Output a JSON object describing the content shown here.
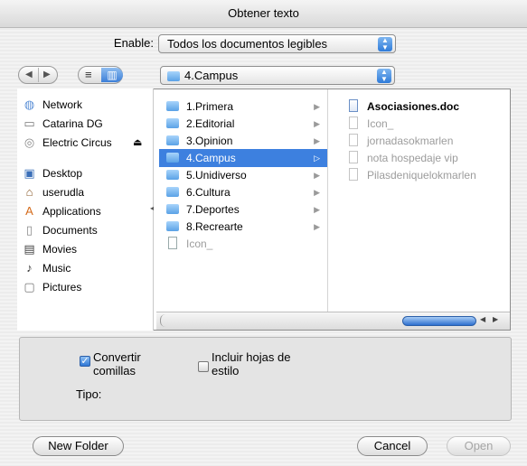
{
  "window": {
    "title": "Obtener texto"
  },
  "enable": {
    "label": "Enable:",
    "value": "Todos los documentos legibles"
  },
  "nav": {
    "back": "◀",
    "forward": "▶",
    "list_view": "≡",
    "column_view": "▥"
  },
  "location": {
    "value": "4.Campus"
  },
  "sidebar": {
    "items": [
      {
        "label": "Network",
        "icon": "network-icon"
      },
      {
        "label": "Catarina DG",
        "icon": "hard-drive-icon"
      },
      {
        "label": "Electric Circus",
        "icon": "cd-icon",
        "eject": "⏏"
      },
      {
        "label": "Desktop",
        "icon": "desktop-icon"
      },
      {
        "label": "userudla",
        "icon": "home-icon"
      },
      {
        "label": "Applications",
        "icon": "applications-icon"
      },
      {
        "label": "Documents",
        "icon": "documents-icon"
      },
      {
        "label": "Movies",
        "icon": "movies-icon"
      },
      {
        "label": "Music",
        "icon": "music-icon"
      },
      {
        "label": "Pictures",
        "icon": "pictures-icon"
      }
    ]
  },
  "column1": {
    "items": [
      {
        "label": "1.Primera",
        "type": "folder"
      },
      {
        "label": "2.Editorial",
        "type": "folder"
      },
      {
        "label": "3.Opinion",
        "type": "folder"
      },
      {
        "label": "4.Campus",
        "type": "folder",
        "selected": true
      },
      {
        "label": "5.Unidiverso",
        "type": "folder"
      },
      {
        "label": "6.Cultura",
        "type": "folder"
      },
      {
        "label": "7.Deportes",
        "type": "folder"
      },
      {
        "label": "8.Recrearte",
        "type": "folder"
      },
      {
        "label": "Icon_",
        "type": "file",
        "disabled": true
      }
    ]
  },
  "column2": {
    "items": [
      {
        "label": "Asociasiones.doc",
        "disabled": false
      },
      {
        "label": "Icon_",
        "disabled": true
      },
      {
        "label": "jornadasokmarlen",
        "disabled": true
      },
      {
        "label": "nota hospedaje vip",
        "disabled": true
      },
      {
        "label": "Pilasdeniquelokmarlen",
        "disabled": true
      }
    ]
  },
  "options": {
    "convert_quotes": {
      "label_line1": "Convertir",
      "label_line2": "comillas",
      "checked": true
    },
    "include_styles": {
      "label_line1": "Incluir hojas de",
      "label_line2": "estilo",
      "checked": false
    },
    "type_label": "Tipo:"
  },
  "buttons": {
    "new_folder": "New Folder",
    "cancel": "Cancel",
    "open": "Open"
  },
  "colors": {
    "selection": "#3d80df",
    "accent": "#2f7bd9"
  }
}
